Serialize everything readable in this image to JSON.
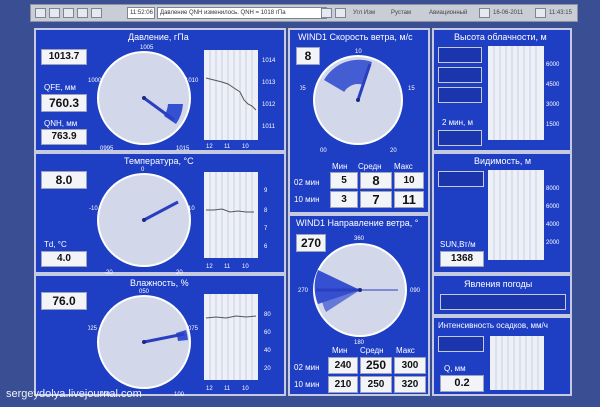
{
  "window": {
    "title_time": "11:52:06",
    "title_text": "Давление QNH изменилось. QNH = 1018 гПа",
    "status_right": "Угл Изм",
    "user": "Рустам",
    "field_label": "Авиационный",
    "date": "16-06-2011",
    "clock": "11:43:15"
  },
  "pressure": {
    "title": "Давление, гПа",
    "main_value": "1013.7",
    "qfe_label": "QFE, мм",
    "qfe_value": "760.3",
    "qnh_label": "QNH, мм",
    "qnh_value": "763.9",
    "dial_labels": [
      "1005",
      "1000",
      "1010",
      "0995",
      "1015"
    ],
    "trend_ticks": [
      "1014",
      "1013",
      "1012",
      "1011"
    ],
    "time_ticks": [
      "12",
      "11",
      "10"
    ]
  },
  "temperature": {
    "title": "Температура, °С",
    "main_value": "8.0",
    "td_label": "Td, °C",
    "td_value": "4.0",
    "dial_labels": [
      "0",
      "-10",
      "10",
      "-20",
      "20"
    ],
    "trend_ticks": [
      "9",
      "8",
      "7",
      "6"
    ],
    "time_ticks": [
      "12",
      "11",
      "10"
    ]
  },
  "humidity": {
    "title": "Влажность, %",
    "main_value": "76.0",
    "dial_labels": [
      "050",
      "025",
      "075",
      "000",
      "100"
    ],
    "trend_ticks": [
      "80",
      "60",
      "40",
      "20"
    ],
    "time_ticks": [
      "12",
      "11",
      "10"
    ]
  },
  "wind_speed": {
    "title": "WIND1 Скорость ветра, м/с",
    "main_value": "8",
    "dial_labels": [
      "10",
      "05",
      "15",
      "00",
      "20"
    ],
    "header": [
      "Мин",
      "Средн",
      "Макс"
    ],
    "rows": [
      {
        "label": "02 мин",
        "values": [
          "5",
          "8",
          "10"
        ]
      },
      {
        "label": "10 мин",
        "values": [
          "3",
          "7",
          "11"
        ]
      }
    ]
  },
  "wind_dir": {
    "title": "WIND1 Направление ветра, °",
    "main_value": "270",
    "dial_labels": [
      "360",
      "270",
      "090",
      "180"
    ],
    "header": [
      "Мин",
      "Средн",
      "Макс"
    ],
    "rows": [
      {
        "label": "02 мин",
        "values": [
          "240",
          "250",
          "300"
        ]
      },
      {
        "label": "10 мин",
        "values": [
          "210",
          "250",
          "320"
        ]
      }
    ]
  },
  "cloud": {
    "title": "Высота облачности, м",
    "period_label": "2 мин, м",
    "ticks": [
      "6000",
      "4500",
      "3000",
      "1500"
    ]
  },
  "visibility": {
    "title": "Видимость, м",
    "sun_label": "SUN,Вт/м",
    "sun_value": "1368",
    "ticks": [
      "8000",
      "6000",
      "4000",
      "2000"
    ]
  },
  "weather": {
    "title": "Явления погоды"
  },
  "precip": {
    "title": "Интенсивность осадков, мм/ч",
    "q_label": "Q, мм",
    "q_value": "0.2"
  },
  "watermark": "sergeydolya.livejournal.com",
  "colors": {
    "panel": "#1e3ec4",
    "background": "#3a4f93",
    "needle": "#2a3fbf",
    "sector": "#3550d0"
  }
}
